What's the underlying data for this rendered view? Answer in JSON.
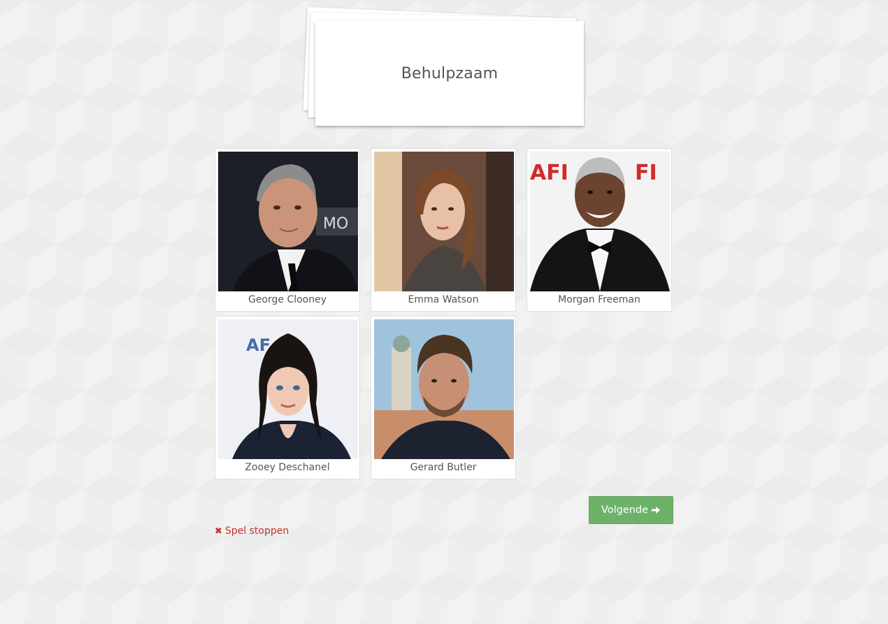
{
  "card": {
    "word": "Behulpzaam"
  },
  "people": [
    {
      "name": "George Clooney"
    },
    {
      "name": "Emma Watson"
    },
    {
      "name": "Morgan Freeman"
    },
    {
      "name": "Zooey Deschanel"
    },
    {
      "name": "Gerard Butler"
    }
  ],
  "actions": {
    "next_label": "Volgende",
    "next_icon": "arrow-right-icon",
    "stop_label": "Spel stoppen",
    "stop_icon": "x-icon"
  },
  "colors": {
    "next_button": "#6eb26a",
    "stop_link": "#c9302c"
  }
}
